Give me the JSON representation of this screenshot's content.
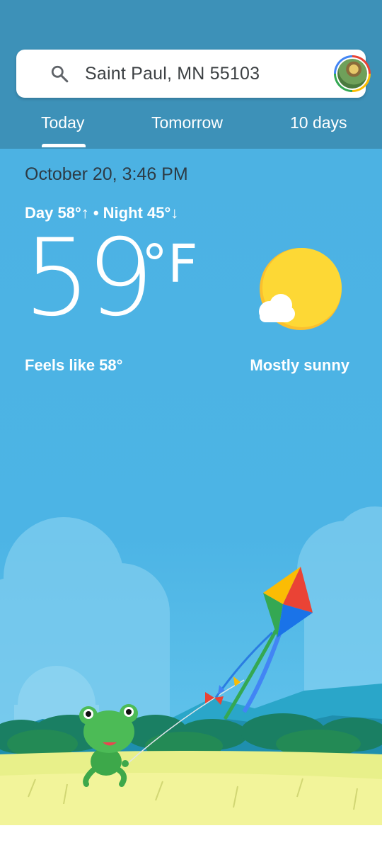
{
  "search": {
    "location": "Saint Paul, MN 55103"
  },
  "tabs": [
    {
      "label": "Today",
      "active": true
    },
    {
      "label": "Tomorrow",
      "active": false
    },
    {
      "label": "10 days",
      "active": false
    }
  ],
  "weather": {
    "datetime": "October 20, 3:46 PM",
    "day_night": "Day 58°↑ • Night 45°↓",
    "temperature": "59",
    "unit": "°F",
    "feels_like": "Feels like 58°",
    "condition": "Mostly sunny"
  },
  "icons": {
    "search": "search-icon",
    "account": "account-avatar",
    "weather": "mostly-sunny-icon"
  },
  "colors": {
    "header": "#3d91b8",
    "sky": "#4cb2e3",
    "sun": "#fdd835"
  }
}
